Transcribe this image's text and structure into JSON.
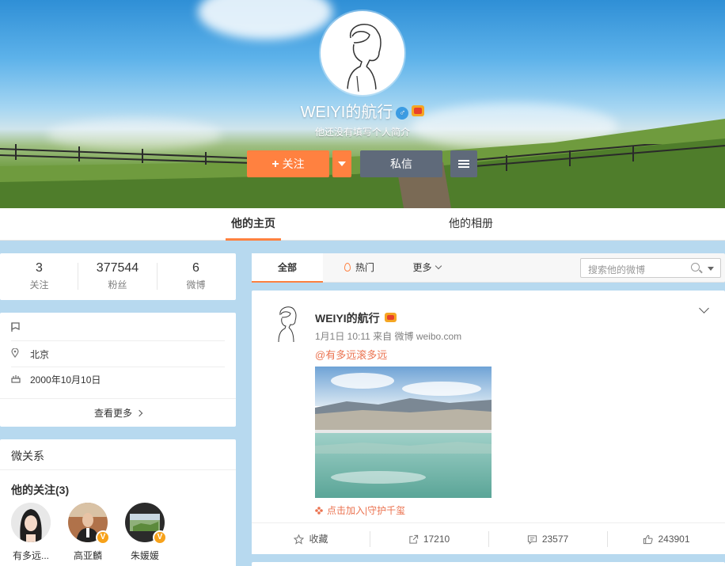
{
  "profile": {
    "name": "WEIYI的航行",
    "gender_symbol": "♂",
    "bio": "他还没有填写个人简介"
  },
  "actions": {
    "follow_plus": "+",
    "follow_label": "关注",
    "message_label": "私信"
  },
  "tabs": {
    "home": "他的主页",
    "album": "他的相册"
  },
  "stats": [
    {
      "num": "3",
      "label": "关注"
    },
    {
      "num": "377544",
      "label": "粉丝"
    },
    {
      "num": "6",
      "label": "微博"
    }
  ],
  "info": {
    "location": "北京",
    "birthday": "2000年10月10日",
    "more": "查看更多"
  },
  "relations": {
    "title": "微关系",
    "following_title": "他的关注(3)",
    "friends": [
      {
        "name": "有多远..."
      },
      {
        "name": "高亚麟",
        "badge": "V"
      },
      {
        "name": "朱媛媛",
        "badge": "V"
      }
    ]
  },
  "filter": {
    "all": "全部",
    "hot": "热门",
    "more": "更多",
    "search_placeholder": "搜索他的微博"
  },
  "post": {
    "author": "WEIYI的航行",
    "meta": "1月1日 10:11 来自 微博 weibo.com",
    "text": "@有多远滚多远",
    "sub_link": "点击加入|守护千玺",
    "actions": {
      "favorite": "收藏",
      "repost": "17210",
      "comment": "23577",
      "like": "243901"
    }
  },
  "colors": {
    "accent": "#ff8140",
    "link": "#eb7350",
    "dark_button": "#5f6a7a",
    "page_bg": "#b7d9ef"
  },
  "icons": [
    "gender-male-icon",
    "crown-icon",
    "plus-icon",
    "chevron-down-icon",
    "menu-icon",
    "flag-icon",
    "location-icon",
    "cake-icon",
    "chevron-right-icon",
    "flame-icon",
    "search-icon",
    "star-icon",
    "repost-icon",
    "comment-icon",
    "like-icon",
    "verified-badge-icon"
  ]
}
